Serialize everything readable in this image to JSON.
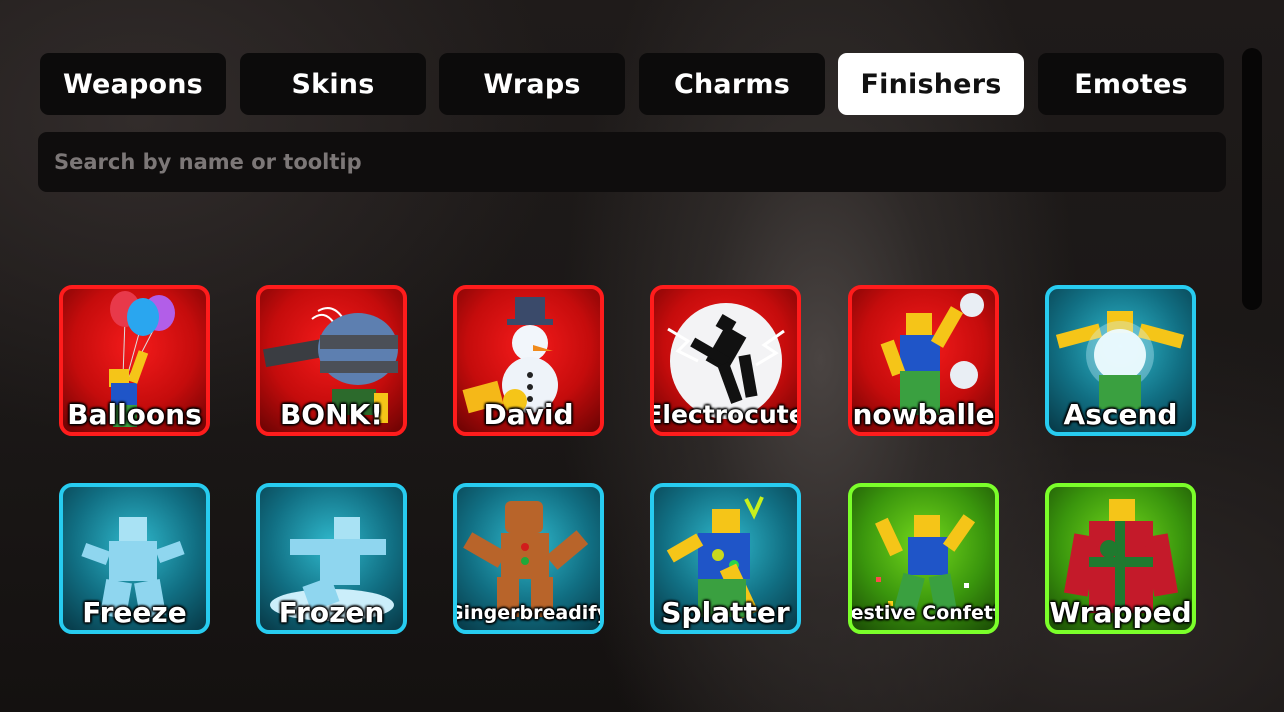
{
  "tabs": [
    {
      "label": "Weapons",
      "active": false
    },
    {
      "label": "Skins",
      "active": false
    },
    {
      "label": "Wraps",
      "active": false
    },
    {
      "label": "Charms",
      "active": false
    },
    {
      "label": "Finishers",
      "active": true
    },
    {
      "label": "Emotes",
      "active": false
    }
  ],
  "search": {
    "placeholder": "Search by name or tooltip",
    "value": ""
  },
  "finishers": [
    {
      "name": "Balloons",
      "rarity_color": "#ff1c1c",
      "icon": "balloons-icon"
    },
    {
      "name": "BONK!",
      "rarity_color": "#ff1c1c",
      "icon": "bonk-hammer-icon"
    },
    {
      "name": "David",
      "rarity_color": "#ff1c1c",
      "icon": "snowman-icon"
    },
    {
      "name": "Electrocute",
      "rarity_color": "#ff1c1c",
      "icon": "skeleton-shock-icon"
    },
    {
      "name": "Snowballed",
      "rarity_color": "#ff1c1c",
      "icon": "snowball-hit-icon"
    },
    {
      "name": "Ascend",
      "rarity_color": "#27ccf0",
      "icon": "ascend-glow-icon"
    },
    {
      "name": "Freeze",
      "rarity_color": "#27ccf0",
      "icon": "ice-figure-icon"
    },
    {
      "name": "Frozen",
      "rarity_color": "#27ccf0",
      "icon": "frozen-figure-icon"
    },
    {
      "name": "Gingerbreadify",
      "rarity_color": "#27ccf0",
      "icon": "gingerbread-icon"
    },
    {
      "name": "Splatter",
      "rarity_color": "#27ccf0",
      "icon": "paint-splatter-icon"
    },
    {
      "name": "Festive Confetti",
      "rarity_color": "#7bff2a",
      "icon": "confetti-icon"
    },
    {
      "name": "Wrapped",
      "rarity_color": "#7bff2a",
      "icon": "gift-wrap-icon"
    }
  ]
}
